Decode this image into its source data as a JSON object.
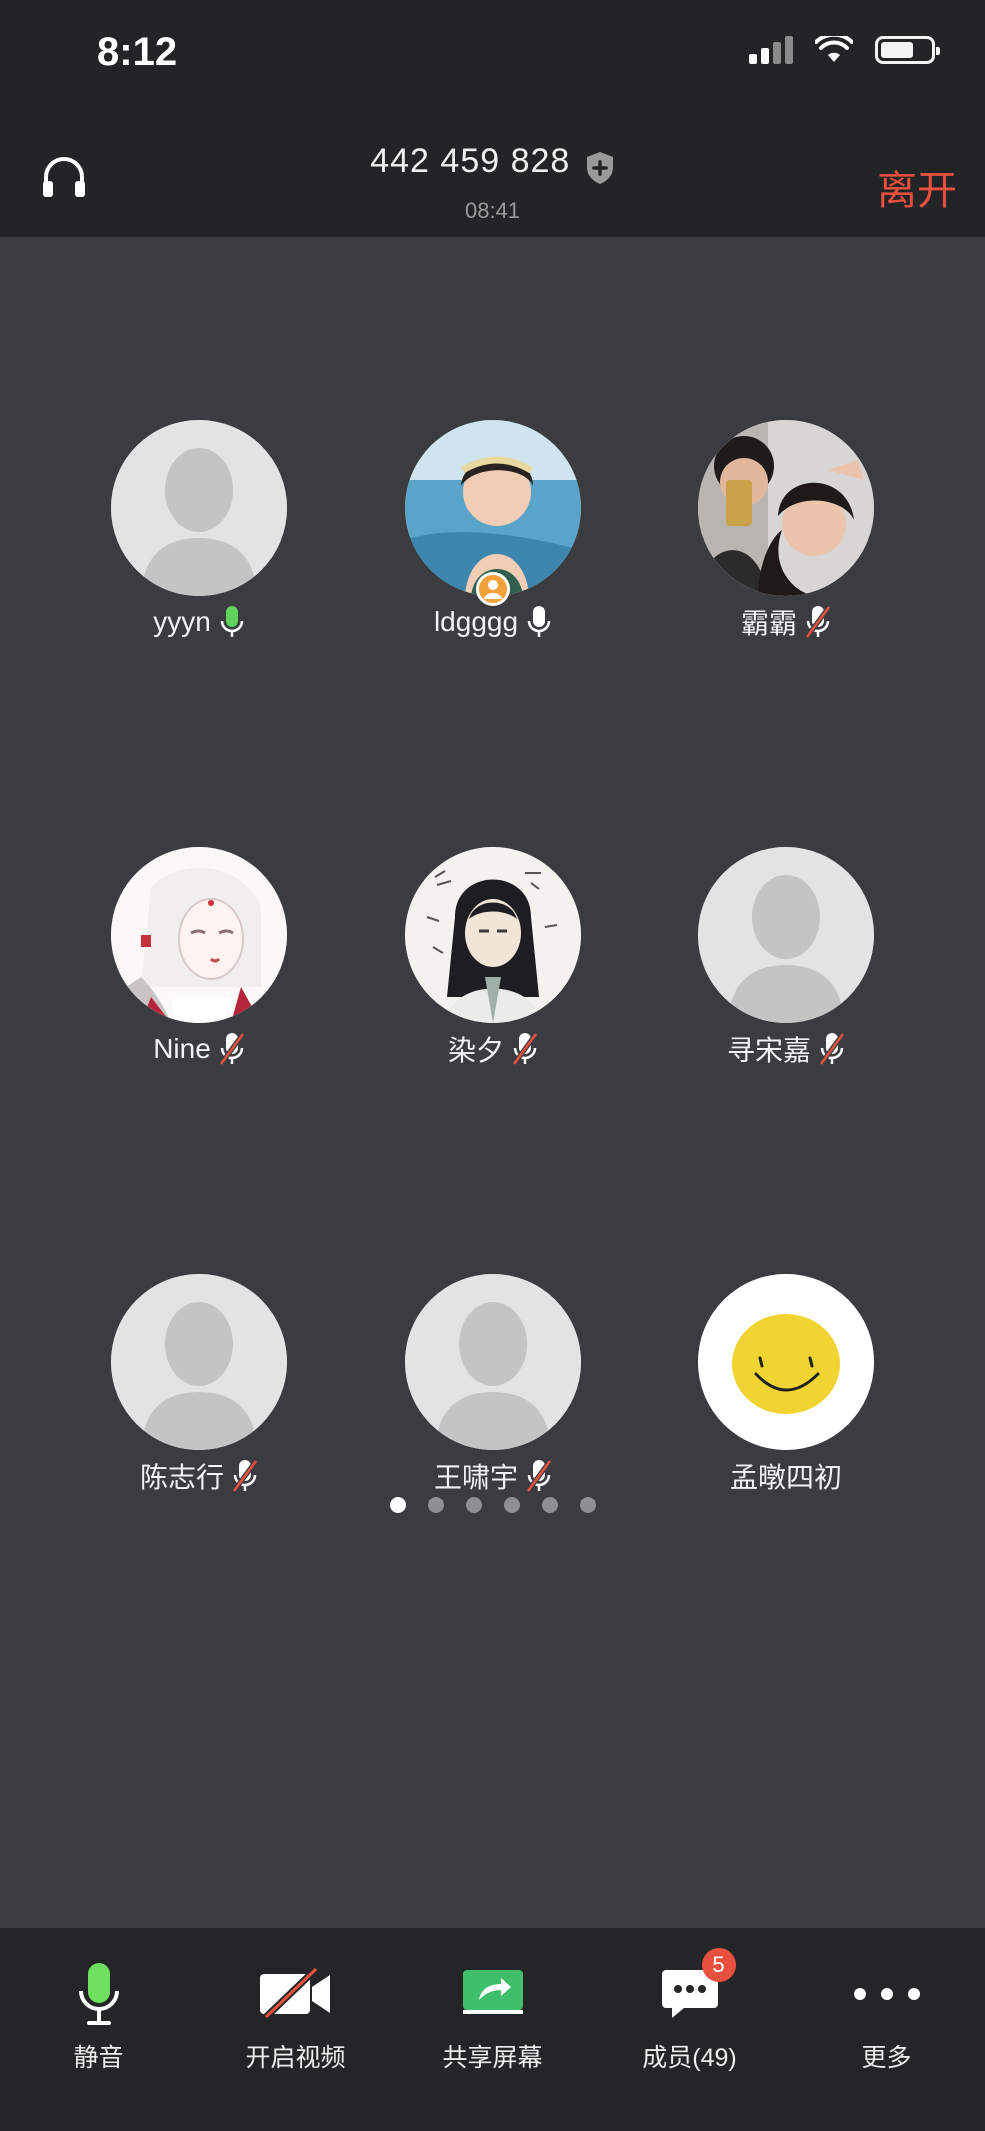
{
  "status": {
    "time": "8:12"
  },
  "header": {
    "meeting_id": "442 459 828",
    "duration": "08:41",
    "leave_label": "离开"
  },
  "participants": [
    {
      "name": "yyyn",
      "mic": "active",
      "avatar": "default"
    },
    {
      "name": "ldgggg",
      "mic": "on",
      "avatar": "photo-child",
      "host": true
    },
    {
      "name": "霸霸",
      "mic": "muted",
      "avatar": "photo-couple"
    },
    {
      "name": "Nine",
      "mic": "muted",
      "avatar": "illustration-girl"
    },
    {
      "name": "染夕",
      "mic": "muted",
      "avatar": "illustration-boy"
    },
    {
      "name": "寻宋嘉",
      "mic": "muted",
      "avatar": "default"
    },
    {
      "name": "陈志行",
      "mic": "muted",
      "avatar": "default"
    },
    {
      "name": "王啸宇",
      "mic": "muted",
      "avatar": "default"
    },
    {
      "name": "孟暾四初",
      "mic": "none",
      "avatar": "smiley"
    }
  ],
  "pager": {
    "pages": 6,
    "current": 1
  },
  "toolbar": {
    "mute_label": "静音",
    "video_label": "开启视频",
    "share_label": "共享屏幕",
    "members_label": "成员(49)",
    "members_badge": "5",
    "more_label": "更多"
  },
  "colors": {
    "accent_red": "#e9503f",
    "mic_active": "#5fd35a",
    "share_green": "#3fbf6a"
  }
}
